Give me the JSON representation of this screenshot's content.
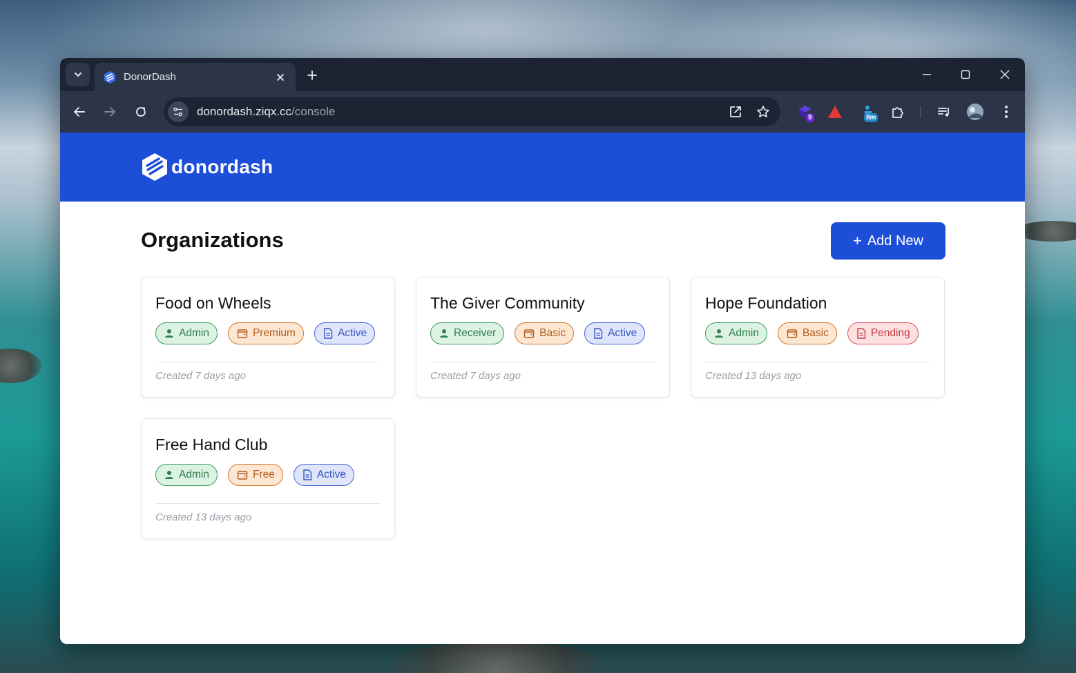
{
  "browser": {
    "tab_title": "DonorDash",
    "url_host": "donordash.ziqx.cc",
    "url_path": "/console",
    "extension_badges": {
      "ext1": "9",
      "ext3": "8m"
    }
  },
  "site": {
    "logo_text": "donordash",
    "brand_color": "#1d4ed8"
  },
  "main": {
    "title": "Organizations",
    "add_button_label": "Add New",
    "add_button_icon": "+"
  },
  "organizations": [
    {
      "name": "Food on Wheels",
      "role": "Admin",
      "plan": "Premium",
      "status": "Active",
      "status_color": "blue",
      "created": "Created 7 days ago"
    },
    {
      "name": "The Giver Community",
      "role": "Receiver",
      "plan": "Basic",
      "status": "Active",
      "status_color": "blue",
      "created": "Created 7 days ago"
    },
    {
      "name": "Hope Foundation",
      "role": "Admin",
      "plan": "Basic",
      "status": "Pending",
      "status_color": "red",
      "created": "Created 13 days ago"
    },
    {
      "name": "Free Hand Club",
      "role": "Admin",
      "plan": "Free",
      "status": "Active",
      "status_color": "blue",
      "created": "Created 13 days ago"
    }
  ]
}
